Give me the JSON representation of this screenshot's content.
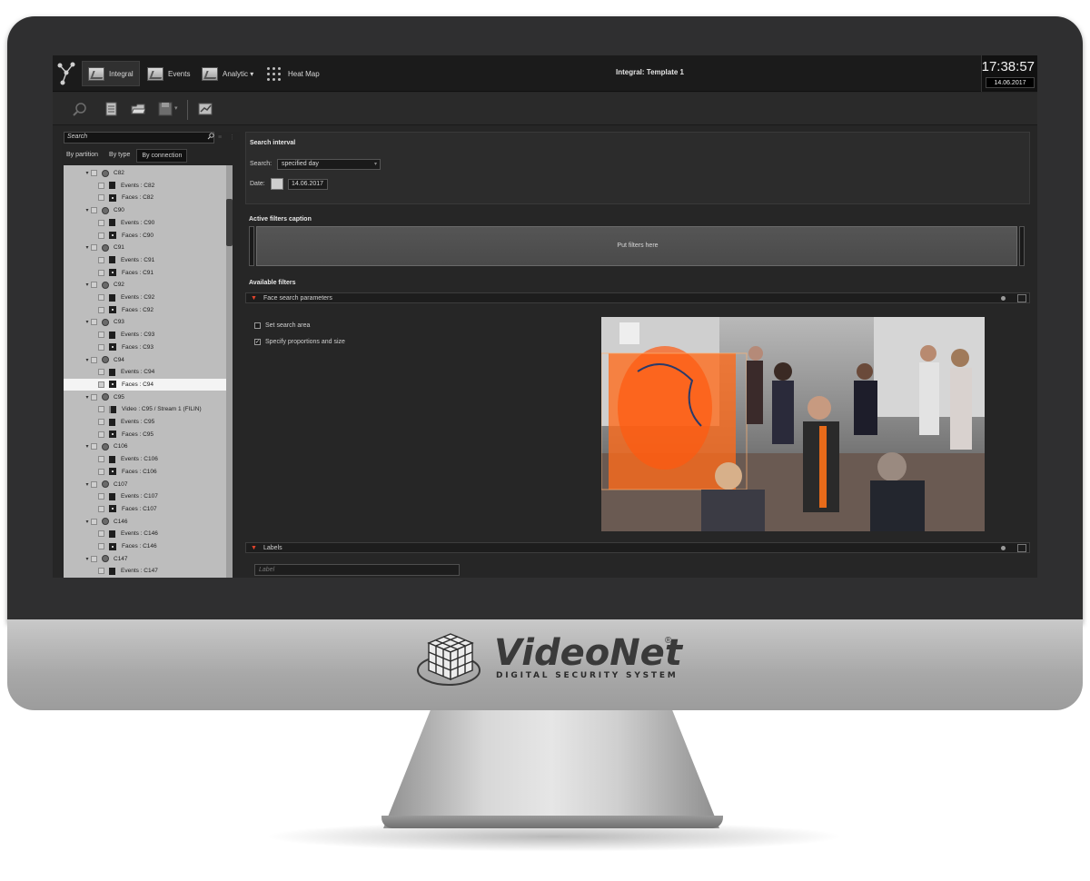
{
  "topbar": {
    "tabs": [
      {
        "label": "Integral",
        "icon": "integral-icon",
        "active": true
      },
      {
        "label": "Events",
        "icon": "events-icon",
        "active": false
      },
      {
        "label": "Analytic ▾",
        "icon": "analytic-icon",
        "active": false
      },
      {
        "label": "Heat Map",
        "icon": "heat-map-icon",
        "active": false
      }
    ],
    "title": "Integral: Template 1",
    "clock_time": "17:38:57",
    "clock_date": "14.06.2017"
  },
  "toolbar": {
    "icons": [
      "search-zoom-icon",
      "notebook-icon",
      "open-folder-icon",
      "save-icon",
      "dropdown-caret-icon",
      "export-icon"
    ]
  },
  "left_panel": {
    "search_placeholder": "Search",
    "view_tabs": [
      "By partition",
      "By type",
      "By connection"
    ],
    "tree": [
      {
        "level": 0,
        "kind": "camera",
        "label": "C82"
      },
      {
        "level": 1,
        "kind": "events",
        "label": "Events : C82"
      },
      {
        "level": 1,
        "kind": "faces",
        "label": "Faces : C82"
      },
      {
        "level": 0,
        "kind": "camera",
        "label": "C90"
      },
      {
        "level": 1,
        "kind": "events",
        "label": "Events : C90"
      },
      {
        "level": 1,
        "kind": "faces",
        "label": "Faces : C90"
      },
      {
        "level": 0,
        "kind": "camera",
        "label": "C91"
      },
      {
        "level": 1,
        "kind": "events",
        "label": "Events : C91"
      },
      {
        "level": 1,
        "kind": "faces",
        "label": "Faces : C91"
      },
      {
        "level": 0,
        "kind": "camera",
        "label": "C92"
      },
      {
        "level": 1,
        "kind": "events",
        "label": "Events : C92"
      },
      {
        "level": 1,
        "kind": "faces",
        "label": "Faces : C92"
      },
      {
        "level": 0,
        "kind": "camera",
        "label": "C93"
      },
      {
        "level": 1,
        "kind": "events",
        "label": "Events : C93"
      },
      {
        "level": 1,
        "kind": "faces",
        "label": "Faces : C93"
      },
      {
        "level": 0,
        "kind": "camera",
        "label": "C94"
      },
      {
        "level": 1,
        "kind": "events",
        "label": "Events : C94"
      },
      {
        "level": 1,
        "kind": "faces",
        "label": "Faces : C94",
        "selected": true
      },
      {
        "level": 0,
        "kind": "camera",
        "label": "C95"
      },
      {
        "level": 1,
        "kind": "video",
        "label": "Video : C95 / Stream 1 (FILIN)"
      },
      {
        "level": 1,
        "kind": "events",
        "label": "Events : C95"
      },
      {
        "level": 1,
        "kind": "faces",
        "label": "Faces : C95"
      },
      {
        "level": 0,
        "kind": "camera",
        "label": "C106"
      },
      {
        "level": 1,
        "kind": "events",
        "label": "Events : C106"
      },
      {
        "level": 1,
        "kind": "faces",
        "label": "Faces : C106"
      },
      {
        "level": 0,
        "kind": "camera",
        "label": "C107"
      },
      {
        "level": 1,
        "kind": "events",
        "label": "Events : C107"
      },
      {
        "level": 1,
        "kind": "faces",
        "label": "Faces : C107"
      },
      {
        "level": 0,
        "kind": "camera",
        "label": "C146"
      },
      {
        "level": 1,
        "kind": "events",
        "label": "Events : C146"
      },
      {
        "level": 1,
        "kind": "faces",
        "label": "Faces : C146"
      },
      {
        "level": 0,
        "kind": "camera",
        "label": "C147"
      },
      {
        "level": 1,
        "kind": "events",
        "label": "Events : C147"
      }
    ]
  },
  "search_interval": {
    "title": "Search interval",
    "search_label": "Search:",
    "search_value": "specified day",
    "date_label": "Date:",
    "date_value": "14.06.2017"
  },
  "active_filters": {
    "title": "Active filters caption",
    "drop_hint": "Put filters here"
  },
  "available_filters": {
    "title": "Available filters",
    "face_group": "Face search parameters",
    "options": [
      {
        "label": "Set search area",
        "checked": false
      },
      {
        "label": "Specify proportions and size",
        "checked": true
      }
    ],
    "labels_group": "Labels",
    "label_placeholder": "Label"
  },
  "brand": {
    "name": "VideoNet",
    "registered": "®",
    "tagline": "DIGITAL SECURITY SYSTEM"
  },
  "colors": {
    "accent_arrow": "#e2442c",
    "overlay_orange": "#ff6a1a"
  }
}
